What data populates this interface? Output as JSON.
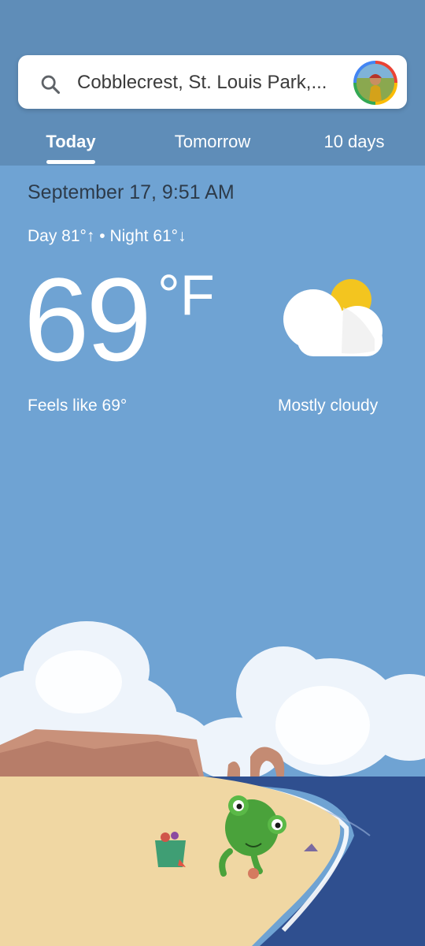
{
  "search": {
    "query": "Cobblecrest, St. Louis Park,..."
  },
  "tabs": [
    {
      "label": "Today"
    },
    {
      "label": "Tomorrow"
    },
    {
      "label": "10 days"
    }
  ],
  "current": {
    "date_time": "September 17, 9:51 AM",
    "day_night": "Day 81°↑ • Night 61°↓",
    "temperature": "69",
    "unit": "°F",
    "feels_like": "Feels like 69°",
    "condition": "Mostly cloudy",
    "condition_icon": "mostly-cloudy-icon"
  },
  "colors": {
    "header": "#5f8db8",
    "sky": "#6fa3d3",
    "sun": "#f3c51f",
    "sea": "#2f4f8f",
    "sand": "#f0d7a3"
  }
}
